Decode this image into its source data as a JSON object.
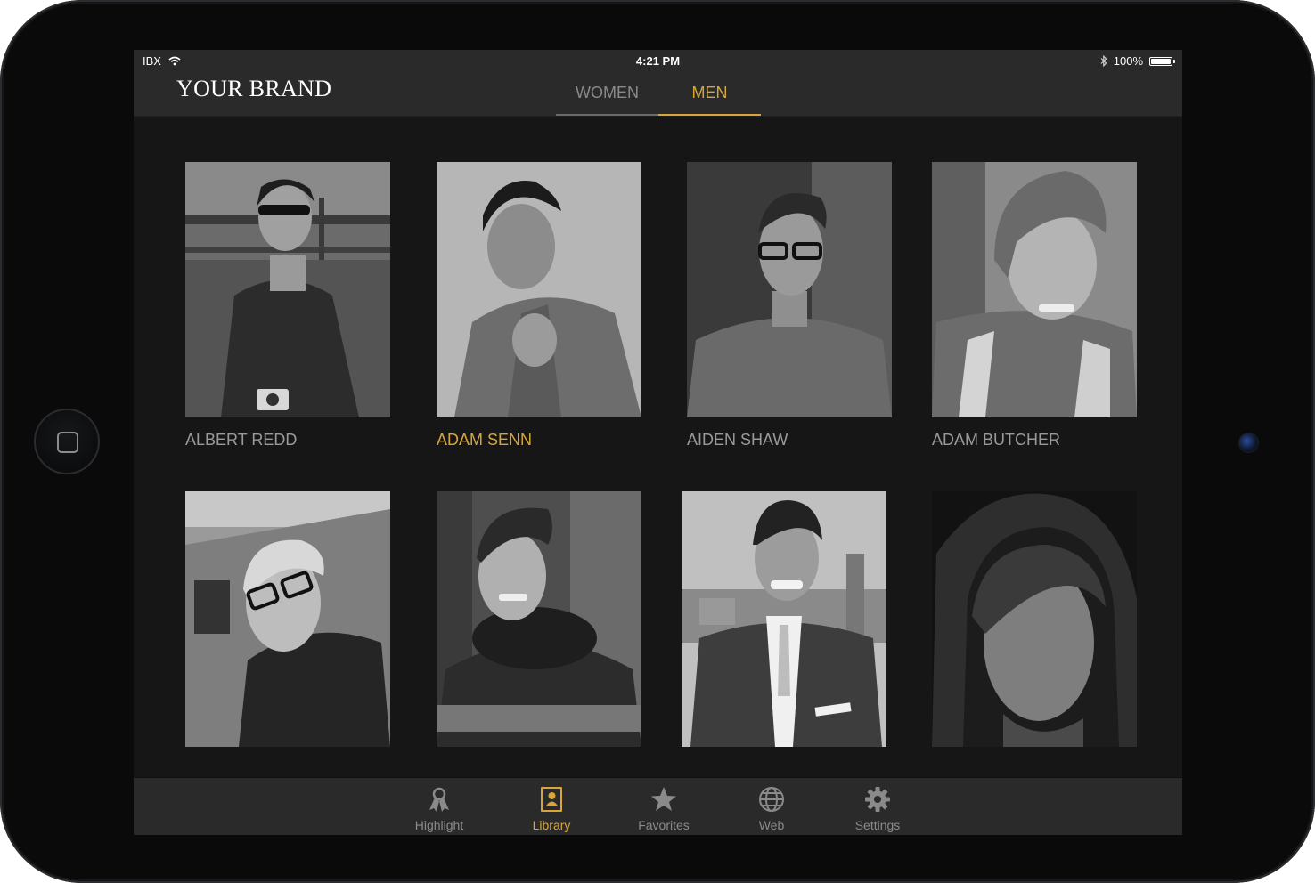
{
  "status_bar": {
    "carrier": "IBX",
    "time": "4:21 PM",
    "battery": "100%"
  },
  "header": {
    "brand": "YOUR BRAND",
    "segments": [
      {
        "label": "WOMEN",
        "selected": false
      },
      {
        "label": "MEN",
        "selected": true
      }
    ]
  },
  "grid": {
    "cards": [
      {
        "name": "ALBERT REDD",
        "selected": false
      },
      {
        "name": "ADAM SENN",
        "selected": true
      },
      {
        "name": "AIDEN SHAW",
        "selected": false
      },
      {
        "name": "ADAM BUTCHER",
        "selected": false
      },
      {
        "name": "",
        "selected": false
      },
      {
        "name": "",
        "selected": false
      },
      {
        "name": "",
        "selected": false
      },
      {
        "name": "",
        "selected": false
      }
    ]
  },
  "tab_bar": {
    "items": [
      {
        "label": "Highlight",
        "icon": "ribbon-icon",
        "active": false
      },
      {
        "label": "Library",
        "icon": "contact-book-icon",
        "active": true
      },
      {
        "label": "Favorites",
        "icon": "star-icon",
        "active": false
      },
      {
        "label": "Web",
        "icon": "globe-icon",
        "active": false
      },
      {
        "label": "Settings",
        "icon": "gear-icon",
        "active": false
      }
    ]
  },
  "colors": {
    "accent": "#d7a53a",
    "header_bg": "#2a2a2a",
    "screen_bg": "#161616",
    "inactive_text": "#8a8a8a"
  }
}
